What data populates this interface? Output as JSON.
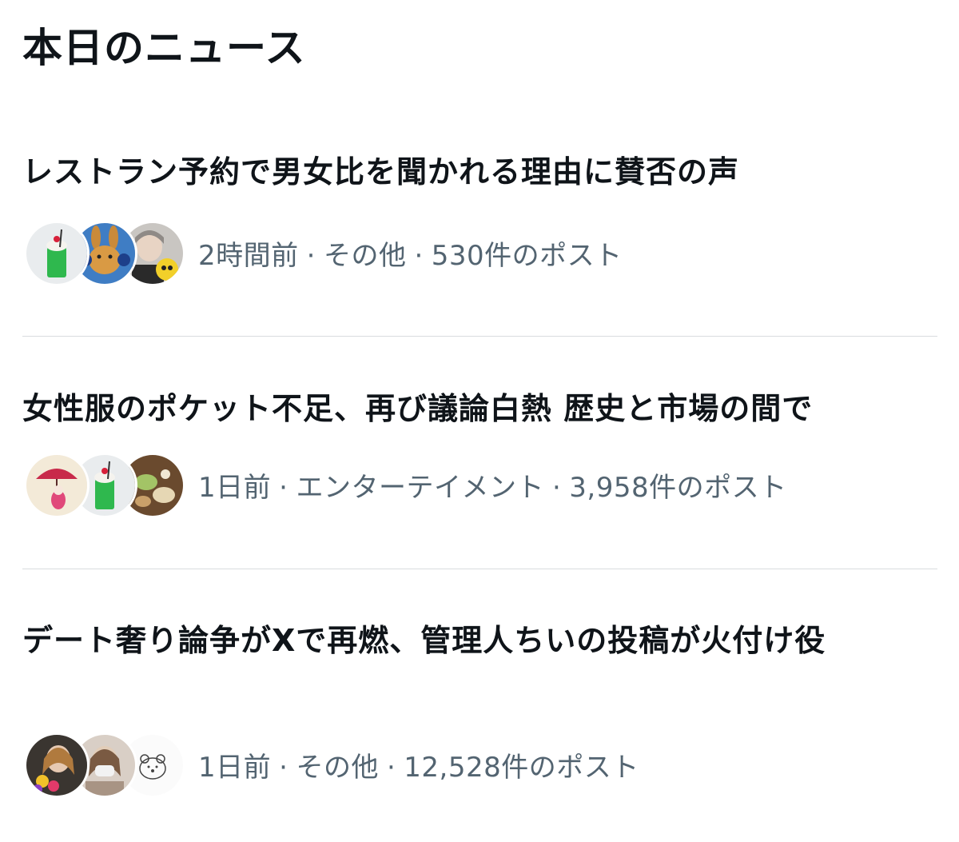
{
  "section_title": "本日のニュース",
  "colors": {
    "text_primary": "#0f1419",
    "text_secondary": "#536471",
    "divider": "#d9dcdf"
  },
  "items": [
    {
      "title": "レストラン予約で男女比を聞かれる理由に賛否の声",
      "time": "2時間前",
      "category": "その他",
      "posts": "530件のポスト",
      "avatars": [
        "green-cream-soda-avatar",
        "cartoon-dog-headphones-avatar",
        "person-with-toy-avatar"
      ]
    },
    {
      "title": "女性服のポケット不足、再び議論白熱 歴史と市場の間で",
      "time": "1日前",
      "category": "エンターテイメント",
      "posts": "3,958件のポスト",
      "avatars": [
        "umbrella-character-avatar",
        "green-cream-soda-avatar",
        "desserts-avatar"
      ]
    },
    {
      "title": "デート奢り論争がXで再燃、管理人ちいの投稿が火付け役",
      "time": "1日前",
      "category": "その他",
      "posts": "12,528件のポスト",
      "avatars": [
        "person-flowers-avatar",
        "person-mask-avatar",
        "bear-doodle-avatar"
      ]
    }
  ],
  "separator": "·"
}
